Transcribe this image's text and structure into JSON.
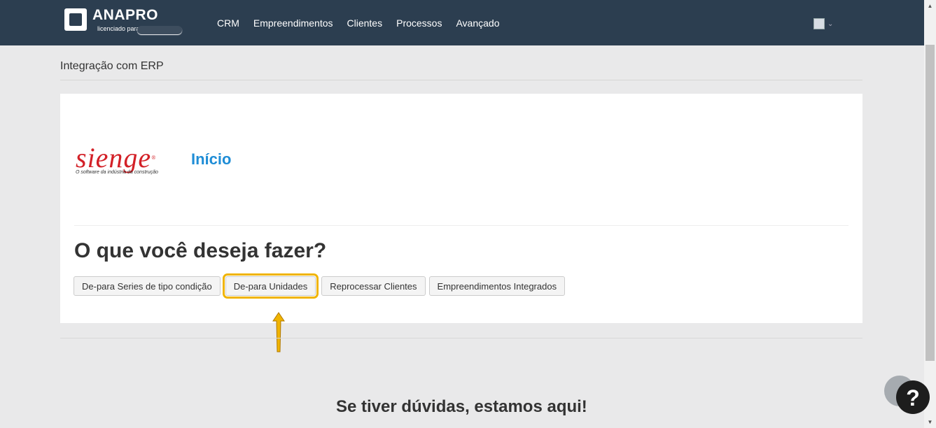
{
  "navbar": {
    "brand_name": "ANAPRO",
    "brand_sub": "licenciado para",
    "links": [
      "CRM",
      "Empreendimentos",
      "Clientes",
      "Processos",
      "Avançado"
    ]
  },
  "page": {
    "title": "Integração com ERP"
  },
  "card": {
    "logo_text": "sienge",
    "logo_tagline": "O software da indústria da construção",
    "heading": "Início",
    "question": "O que você deseja fazer?",
    "buttons": [
      "De-para Series de tipo condição",
      "De-para Unidades",
      "Reprocessar Clientes",
      "Empreendimentos Integrados"
    ],
    "highlighted_button_index": 1
  },
  "footer": {
    "help_title": "Se tiver dúvidas, estamos aqui!",
    "help_icon": "?"
  },
  "colors": {
    "navbar_bg": "#2c3e50",
    "accent_blue": "#1f8dd6",
    "sienge_red": "#d32027",
    "highlight": "#f0b400"
  },
  "icons": {
    "user": "user-avatar-icon",
    "caret": "chevron-down-icon",
    "arrow": "up-arrow-icon",
    "help": "question-mark-icon"
  }
}
